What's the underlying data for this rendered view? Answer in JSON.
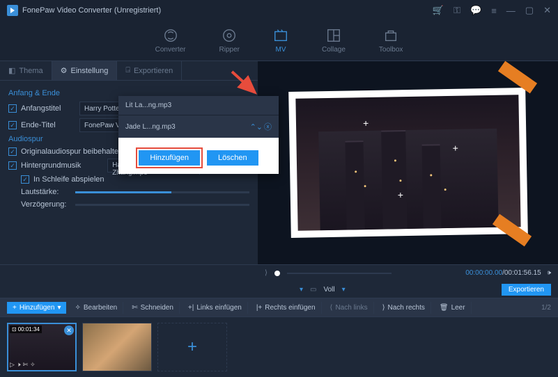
{
  "title": "FonePaw Video Converter (Unregistriert)",
  "nav": {
    "converter": "Converter",
    "ripper": "Ripper",
    "mv": "MV",
    "collage": "Collage",
    "toolbox": "Toolbox"
  },
  "tabs": {
    "theme": "Thema",
    "settings": "Einstellung",
    "export": "Exportieren"
  },
  "settings": {
    "section_anfang": "Anfang & Ende",
    "start_title_label": "Anfangstitel",
    "start_title_value": "Harry Potter Handyspiel",
    "end_title_label": "Ende-Titel",
    "end_title_value": "FonePaw Video Converter Ultimate",
    "section_audio": "Audiospur",
    "keep_original": "Originalaudiospur beibehalten",
    "bg_music_label": "Hintergrundmusik",
    "bg_music_value": "Happy-Stan... Zhang.mp3",
    "loop_label": "In Schleife abspielen",
    "volume_label": "Lautstärke:",
    "delay_label": "Verzögerung:"
  },
  "popup": {
    "item1": "Lit La...ng.mp3",
    "item2": "Jade L...ng.mp3",
    "add": "Hinzufügen",
    "delete": "Löschen"
  },
  "time": {
    "current": "00:00:00.00",
    "total": "00:01:56.15",
    "voll": "Voll"
  },
  "export_btn": "Exportieren",
  "toolbar": {
    "add": "Hinzufügen",
    "edit": "Bearbeiten",
    "cut": "Schneiden",
    "insert_left": "Links einfügen",
    "insert_right": "Rechts einfügen",
    "move_left": "Nach links",
    "move_right": "Nach rechts",
    "clear": "Leer",
    "page": "1/2"
  },
  "clip": {
    "duration": "00:01:34"
  }
}
